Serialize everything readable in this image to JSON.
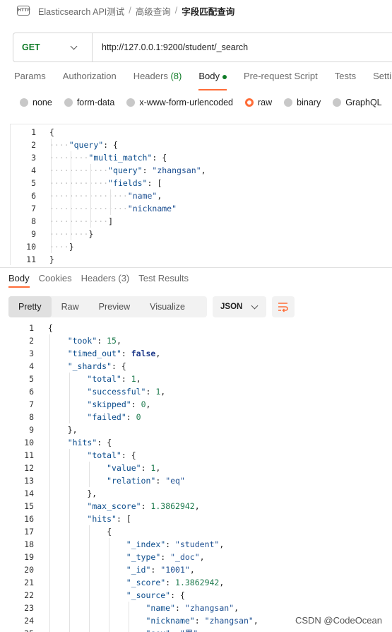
{
  "breadcrumb": {
    "collection": "Elasticsearch API测试",
    "folder": "高级查询",
    "current": "字段匹配查询",
    "icon": "http-icon"
  },
  "request": {
    "method": "GET",
    "url": "http://127.0.0.1:9200/student/_search"
  },
  "request_tabs": [
    {
      "label": "Params"
    },
    {
      "label": "Authorization"
    },
    {
      "label": "Headers",
      "count": "(8)"
    },
    {
      "label": "Body",
      "active": true,
      "dot": true
    },
    {
      "label": "Pre-request Script"
    },
    {
      "label": "Tests"
    },
    {
      "label": "Setti"
    }
  ],
  "body_modes": [
    {
      "label": "none"
    },
    {
      "label": "form-data"
    },
    {
      "label": "x-www-form-urlencoded"
    },
    {
      "label": "raw",
      "selected": true
    },
    {
      "label": "binary"
    },
    {
      "label": "GraphQL"
    }
  ],
  "request_body_lines": [
    "{",
    "    \"query\": {",
    "        \"multi_match\": {",
    "            \"query\": \"zhangsan\",",
    "            \"fields\": [",
    "                \"name\",",
    "                \"nickname\"",
    "            ]",
    "        }",
    "    }",
    "}"
  ],
  "response_tabs": [
    {
      "label": "Body",
      "active": true
    },
    {
      "label": "Cookies"
    },
    {
      "label": "Headers (3)"
    },
    {
      "label": "Test Results"
    }
  ],
  "view_modes": [
    {
      "label": "Pretty",
      "active": true
    },
    {
      "label": "Raw"
    },
    {
      "label": "Preview"
    },
    {
      "label": "Visualize"
    }
  ],
  "format": "JSON",
  "wrap_icon": "wrap-lines-icon",
  "response_lines": [
    "{",
    "    \"took\": 15,",
    "    \"timed_out\": false,",
    "    \"_shards\": {",
    "        \"total\": 1,",
    "        \"successful\": 1,",
    "        \"skipped\": 0,",
    "        \"failed\": 0",
    "    },",
    "    \"hits\": {",
    "        \"total\": {",
    "            \"value\": 1,",
    "            \"relation\": \"eq\"",
    "        },",
    "        \"max_score\": 1.3862942,",
    "        \"hits\": [",
    "            {",
    "                \"_index\": \"student\",",
    "                \"_type\": \"_doc\",",
    "                \"_id\": \"1001\",",
    "                \"_score\": 1.3862942,",
    "                \"_source\": {",
    "                    \"name\": \"zhangsan\",",
    "                    \"nickname\": \"zhangsan\",",
    "                    \"sex\": \"男\","
  ],
  "watermark": "CSDN @CodeOcean",
  "colors": {
    "accent": "#ff6c37",
    "method_get": "#0f7b27"
  }
}
